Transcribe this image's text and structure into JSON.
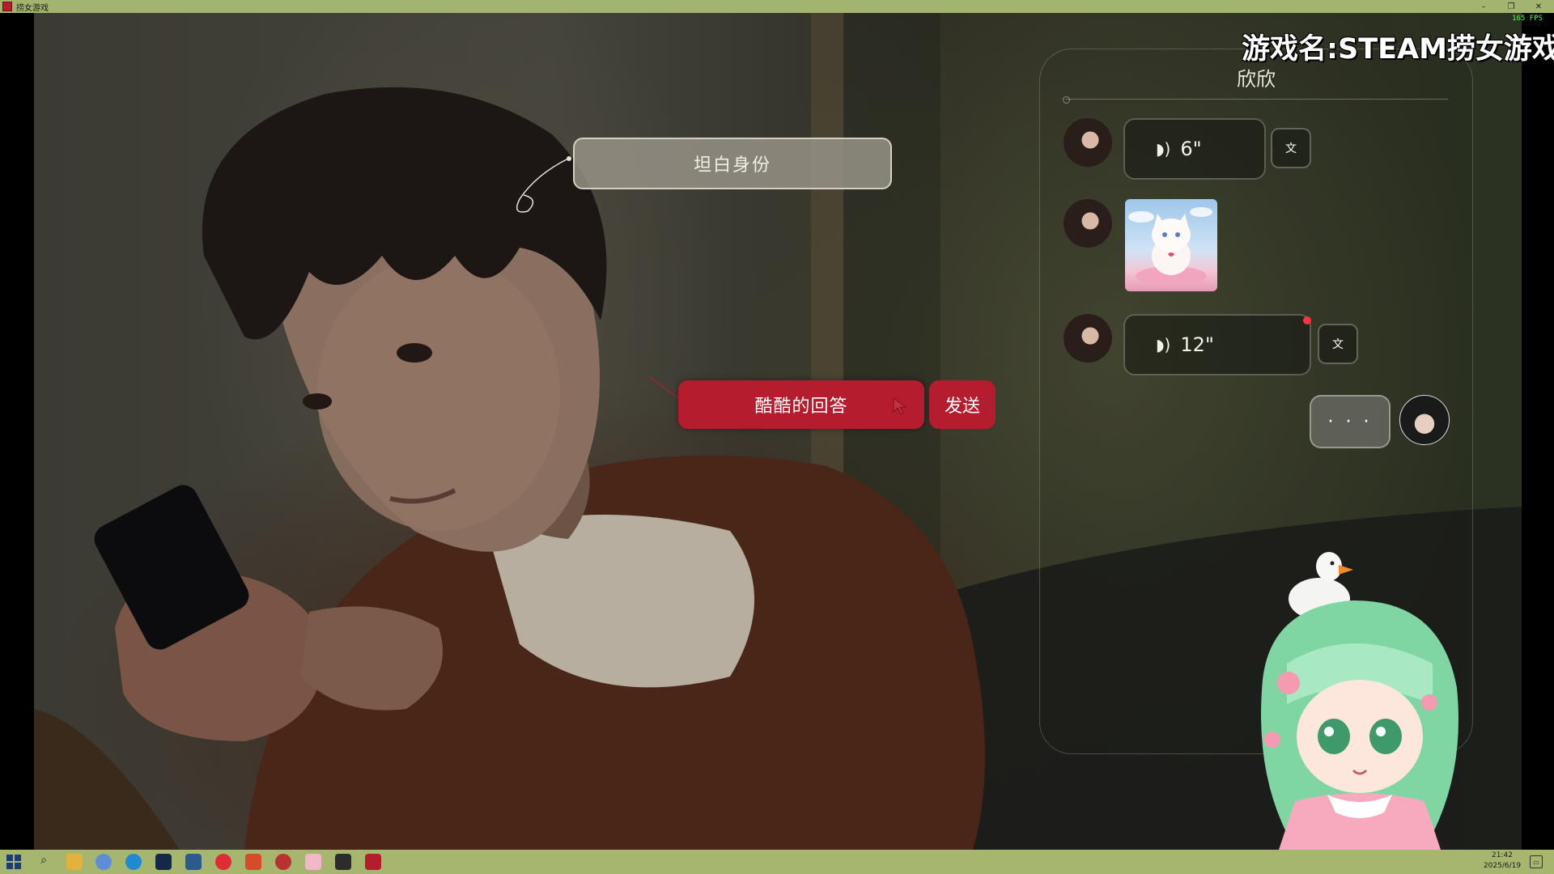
{
  "window": {
    "title": "捞女游戏",
    "fps": "165 FPS",
    "controls": {
      "minimize": "–",
      "maximize": "❐",
      "close": "✕"
    }
  },
  "overlay": {
    "game_name": "游戏名:STEAM捞女游戏"
  },
  "scene": {
    "choices": [
      {
        "label": "坦白身份",
        "style": "neutral"
      },
      {
        "label": "酷酷的回答",
        "style": "selected"
      }
    ],
    "send_label": "发送"
  },
  "chat": {
    "contact_name": "欣欣",
    "messages": [
      {
        "sender": "contact",
        "type": "voice",
        "duration": "6\"",
        "transcribe_label": "文",
        "unread": false
      },
      {
        "sender": "contact",
        "type": "image",
        "image": "cat-sticker"
      },
      {
        "sender": "contact",
        "type": "voice",
        "duration": "12\"",
        "transcribe_label": "文",
        "unread": true
      },
      {
        "sender": "me",
        "type": "typing",
        "text": "· · ·"
      }
    ]
  },
  "taskbar": {
    "icons": [
      "windows-start",
      "search",
      "file-explorer",
      "browser",
      "edge",
      "steam",
      "app-blue",
      "netease-music",
      "app-red",
      "app-mixed",
      "app-pink",
      "app-dark",
      "game-red"
    ],
    "clock_time": "21:42",
    "clock_date": "2025/6/19"
  },
  "colors": {
    "accent_red": "#b51c2e",
    "titlebar": "#a3b46e",
    "fps_green": "#4cff4c"
  }
}
